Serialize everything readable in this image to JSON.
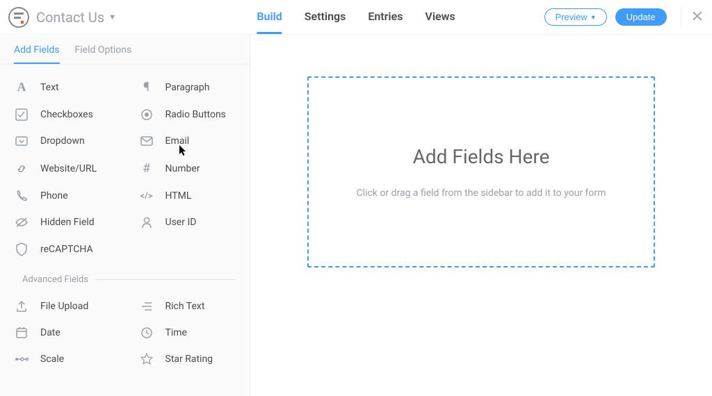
{
  "header": {
    "form_title": "Contact Us",
    "tabs": [
      "Build",
      "Settings",
      "Entries",
      "Views"
    ],
    "active_tab": 0,
    "preview_label": "Preview",
    "update_label": "Update"
  },
  "sidebar": {
    "subtabs": [
      "Add Fields",
      "Field Options"
    ],
    "active_subtab": 0,
    "basic_fields": [
      {
        "icon": "text-icon",
        "label": "Text"
      },
      {
        "icon": "paragraph-icon",
        "label": "Paragraph"
      },
      {
        "icon": "checkbox-icon",
        "label": "Checkboxes"
      },
      {
        "icon": "radio-icon",
        "label": "Radio Buttons"
      },
      {
        "icon": "dropdown-icon",
        "label": "Dropdown"
      },
      {
        "icon": "email-icon",
        "label": "Email"
      },
      {
        "icon": "url-icon",
        "label": "Website/URL"
      },
      {
        "icon": "number-icon",
        "label": "Number"
      },
      {
        "icon": "phone-icon",
        "label": "Phone"
      },
      {
        "icon": "html-icon",
        "label": "HTML"
      },
      {
        "icon": "hidden-icon",
        "label": "Hidden Field"
      },
      {
        "icon": "user-icon",
        "label": "User ID"
      },
      {
        "icon": "recaptcha-icon",
        "label": "reCAPTCHA"
      }
    ],
    "advanced_label": "Advanced Fields",
    "advanced_fields": [
      {
        "icon": "upload-icon",
        "label": "File Upload"
      },
      {
        "icon": "richtext-icon",
        "label": "Rich Text"
      },
      {
        "icon": "date-icon",
        "label": "Date"
      },
      {
        "icon": "time-icon",
        "label": "Time"
      },
      {
        "icon": "scale-icon",
        "label": "Scale"
      },
      {
        "icon": "star-icon",
        "label": "Star Rating"
      }
    ]
  },
  "canvas": {
    "dropzone_title": "Add Fields Here",
    "dropzone_hint": "Click or drag a field from the sidebar to add it to your form"
  }
}
